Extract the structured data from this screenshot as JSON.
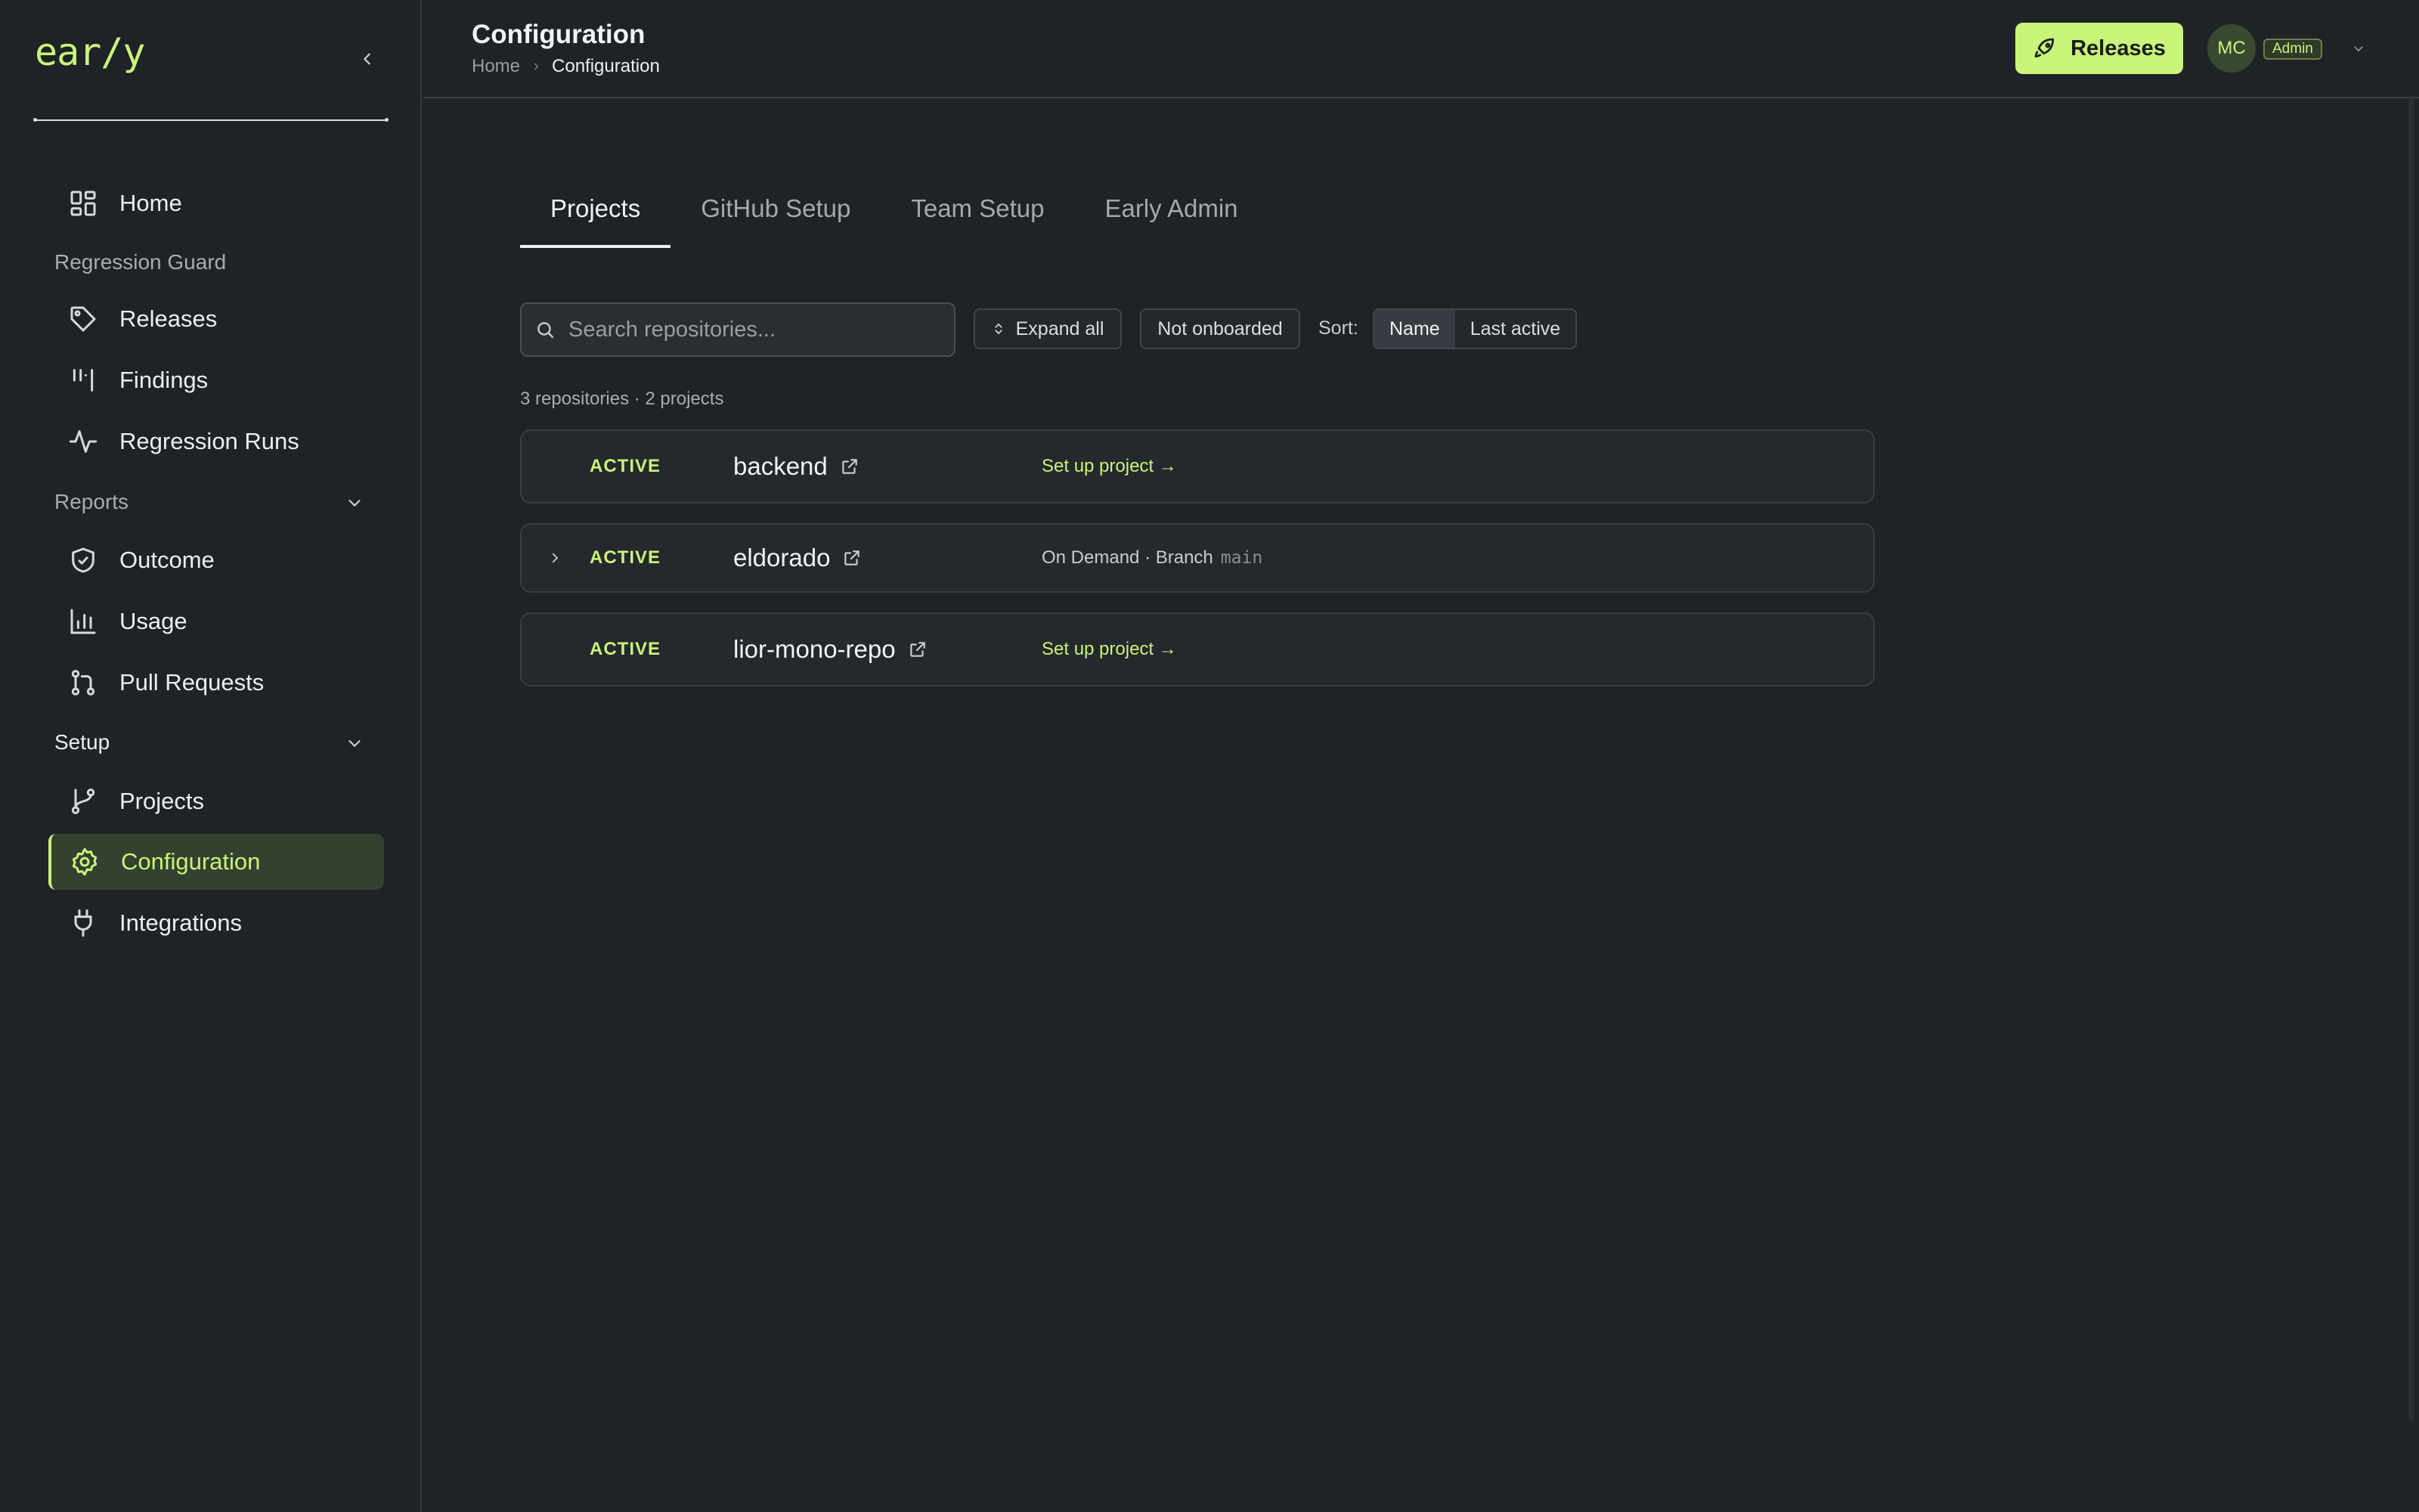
{
  "app": {
    "logo": "ear/y"
  },
  "sidebar": {
    "home": "Home",
    "section_regression": "Regression Guard",
    "releases": "Releases",
    "findings": "Findings",
    "regression_runs": "Regression Runs",
    "section_reports": "Reports",
    "outcome": "Outcome",
    "usage": "Usage",
    "pull_requests": "Pull Requests",
    "section_setup": "Setup",
    "projects": "Projects",
    "configuration": "Configuration",
    "integrations": "Integrations"
  },
  "header": {
    "title": "Configuration",
    "breadcrumb": [
      "Home",
      "Configuration"
    ],
    "releases_button": "Releases",
    "avatar_initials": "MC",
    "role": "Admin"
  },
  "tabs": [
    "Projects",
    "GitHub Setup",
    "Team Setup",
    "Early Admin"
  ],
  "toolbar": {
    "search_placeholder": "Search repositories...",
    "expand_all": "Expand all",
    "not_onboarded": "Not onboarded",
    "sort_label": "Sort:",
    "sort_options": [
      "Name",
      "Last active"
    ]
  },
  "summary": "3 repositories · 2 projects",
  "repos": [
    {
      "status": "ACTIVE",
      "name": "backend",
      "action": "Set up project →"
    },
    {
      "status": "ACTIVE",
      "name": "eldorado",
      "meta_text": "On Demand · Branch",
      "branch": "main"
    },
    {
      "status": "ACTIVE",
      "name": "lior-mono-repo",
      "action": "Set up project →"
    }
  ],
  "colors": {
    "accent": "#c8f57a",
    "background": "#1f2226"
  }
}
